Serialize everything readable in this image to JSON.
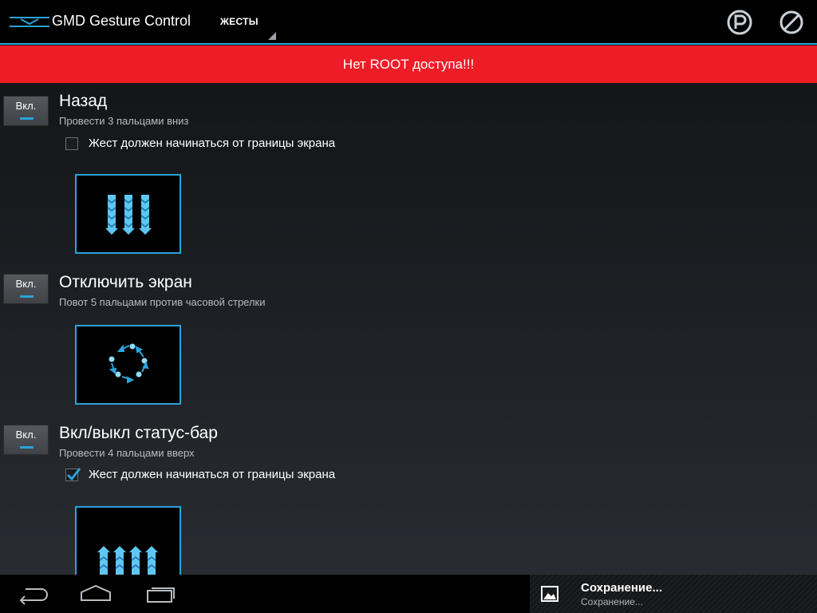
{
  "app": {
    "title": "GMD Gesture Control"
  },
  "spinner": {
    "label": "ЖЕСТЫ"
  },
  "banner": {
    "text": "Нет ROOT доступа!!!"
  },
  "gestures": [
    {
      "toggle": "Вкл.",
      "title": "Назад",
      "subtitle": "Провести 3 пальцами вниз",
      "edge_label": "Жест должен начинаться от границы экрана",
      "edge_checked": false
    },
    {
      "toggle": "Вкл.",
      "title": "Отключить экран",
      "subtitle": "Повот 5 пальцами против часовой стрелки"
    },
    {
      "toggle": "Вкл.",
      "title": "Вкл/выкл статус-бар",
      "subtitle": "Провести 4 пальцами вверх",
      "edge_label": "Жест должен начинаться от границы экрана",
      "edge_checked": true
    }
  ],
  "notification": {
    "title": "Сохранение...",
    "text": "Сохранение..."
  },
  "colors": {
    "accent": "#2aa3d8",
    "banner": "#ee1c25",
    "actionbar": "#000000"
  }
}
